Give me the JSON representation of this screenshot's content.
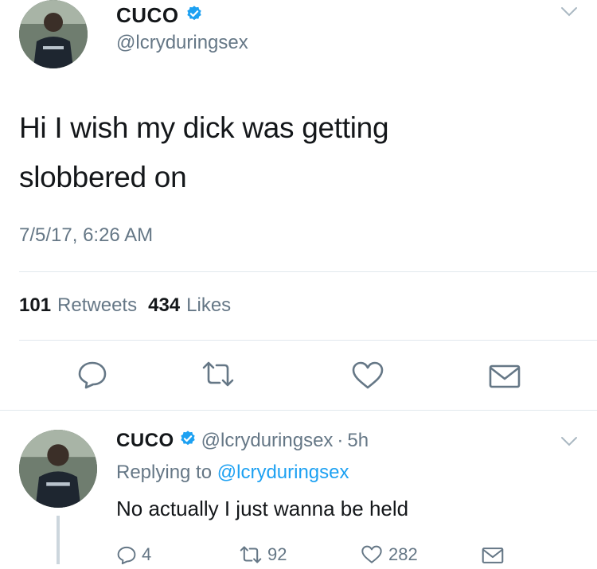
{
  "main_tweet": {
    "display_name": "CUCO",
    "handle": "@lcryduringsex",
    "text_line1": "Hi I wish my dick was getting",
    "text_line2": "slobbered on",
    "timestamp": "7/5/17, 6:26 AM",
    "retweet_count": "101",
    "retweet_label": "Retweets",
    "like_count": "434",
    "like_label": "Likes"
  },
  "reply_tweet": {
    "display_name": "CUCO",
    "handle": "@lcryduringsex",
    "separator": "·",
    "age": "5h",
    "replying_prefix": "Replying to",
    "replying_to": "@lcryduringsex",
    "text": "No actually I just wanna be held",
    "reply_count": "4",
    "retweet_count": "92",
    "like_count": "282"
  },
  "colors": {
    "text": "#14171a",
    "secondary": "#657786",
    "verified": "#1da1f2",
    "link": "#1da1f2",
    "divider": "#e1e8ed",
    "icon": "#657786"
  },
  "icons": {
    "verified": "verified-badge-icon",
    "reply": "speech-bubble-icon",
    "retweet": "retweet-arrows-icon",
    "like": "heart-outline-icon",
    "dm": "envelope-icon",
    "menu": "chevron-down-icon"
  }
}
